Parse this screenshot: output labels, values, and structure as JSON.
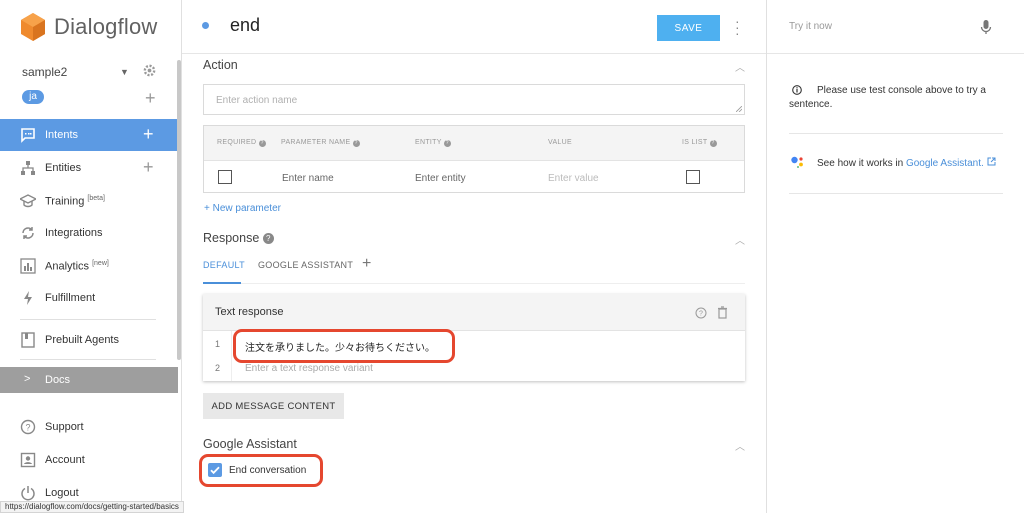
{
  "brand": {
    "name": "Dialogflow"
  },
  "agent": {
    "name": "sample2",
    "language": "ja"
  },
  "sidebar": {
    "items": [
      {
        "label": "Intents"
      },
      {
        "label": "Entities"
      },
      {
        "label": "Training",
        "badge": "[beta]"
      },
      {
        "label": "Integrations"
      },
      {
        "label": "Analytics",
        "badge": "[new]"
      },
      {
        "label": "Fulfillment"
      },
      {
        "label": "Prebuilt Agents"
      },
      {
        "label": "Docs"
      },
      {
        "label": "Support"
      },
      {
        "label": "Account"
      },
      {
        "label": "Logout"
      }
    ]
  },
  "header": {
    "intent_name": "end",
    "save_label": "SAVE"
  },
  "action": {
    "title": "Action",
    "placeholder": "Enter action name",
    "columns": [
      "REQUIRED",
      "PARAMETER NAME",
      "ENTITY",
      "VALUE",
      "IS LIST"
    ],
    "row": {
      "name_placeholder": "Enter name",
      "entity_placeholder": "Enter entity",
      "value_placeholder": "Enter value"
    },
    "new_parameter": "+ New parameter"
  },
  "response": {
    "title": "Response",
    "tabs": [
      "DEFAULT",
      "GOOGLE ASSISTANT"
    ],
    "card_title": "Text response",
    "rows": [
      {
        "num": "1",
        "text": "注文を承りました。少々お待ちください。"
      },
      {
        "num": "2",
        "text": "Enter a text response variant"
      }
    ],
    "add_button": "ADD MESSAGE CONTENT"
  },
  "google_assistant": {
    "title": "Google Assistant",
    "end_conversation": "End conversation",
    "checked": true
  },
  "right_panel": {
    "try_placeholder": "Try it now",
    "info": "Please use test console above to try a sentence.",
    "assistant_prefix": "See how it works in ",
    "assistant_link": "Google Assistant."
  },
  "status_bar": {
    "url": "https://dialogflow.com/docs/getting-started/basics"
  },
  "colors": {
    "accent": "#5c9ae3",
    "save": "#4eb0f0",
    "highlight": "#e5472f",
    "docs_bg": "#9e9e9e"
  }
}
